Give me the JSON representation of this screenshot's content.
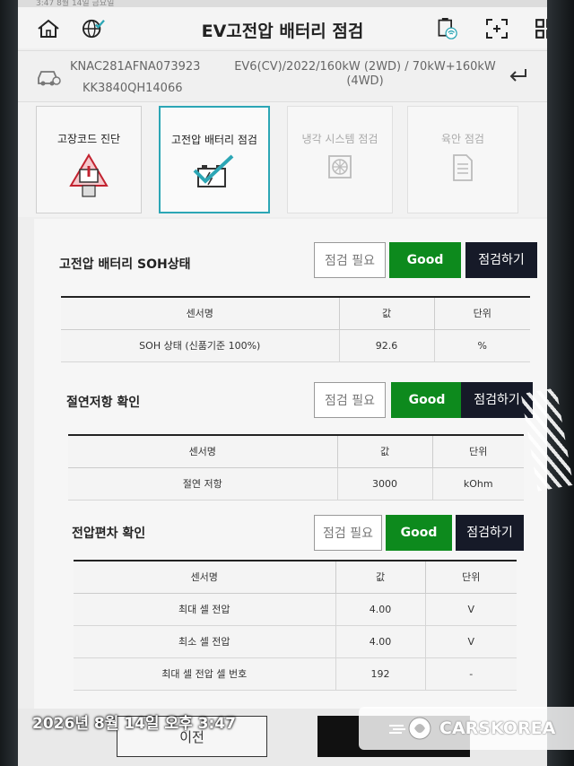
{
  "status_bar": {
    "text": "3:47 8월 14일 금요일"
  },
  "header": {
    "title": "EV고전압 배터리 점검",
    "home_icon": "home-icon",
    "globe_icon": "globe-check-icon",
    "vci_icon": "vci-wifi-icon",
    "expand_icon": "expand-icon",
    "grid_icon": "grid-icon"
  },
  "vehicle": {
    "vin": "KNAC281AFNA073923",
    "plate": "KK3840QH14066",
    "spec": "EV6(CV)/2022/160kW (2WD) / 70kW+160kW (4WD)"
  },
  "tabs": [
    {
      "label": "고장코드 진단",
      "icon": "warning-icon",
      "state": "normal"
    },
    {
      "label": "고전압 배터리 점검",
      "icon": "battery-check-icon",
      "state": "active"
    },
    {
      "label": "냉각 시스템 점검",
      "icon": "cooling-icon",
      "state": "disabled"
    },
    {
      "label": "육안 점검",
      "icon": "document-icon",
      "state": "disabled"
    }
  ],
  "buttons": {
    "need_check": "점검 필요",
    "good": "Good",
    "run_check": "점검하기"
  },
  "table_headers": {
    "name": "센서명",
    "value": "값",
    "unit": "단위"
  },
  "sections": [
    {
      "title": "고전압 배터리 SOH상태",
      "rows": [
        {
          "name": "SOH 상태 (신품기준 100%)",
          "value": "92.6",
          "unit": "%"
        }
      ]
    },
    {
      "title": "절연저항 확인",
      "rows": [
        {
          "name": "절연 저항",
          "value": "3000",
          "unit": "kOhm"
        }
      ]
    },
    {
      "title": "전압편차 확인",
      "rows": [
        {
          "name": "최대 셀 전압",
          "value": "4.00",
          "unit": "V"
        },
        {
          "name": "최소 셀 전압",
          "value": "4.00",
          "unit": "V"
        },
        {
          "name": "최대 셀 전압 셀 번호",
          "value": "192",
          "unit": "-"
        }
      ]
    }
  ],
  "footer": {
    "prev_label": "이전"
  },
  "overlay": {
    "timestamp": "2026년 8월 14일 오후 3:47",
    "watermark": "CARSKOREA"
  },
  "colors": {
    "good": "#0d8a1d",
    "check": "#161a28",
    "active_tab": "#2ca6b5"
  }
}
